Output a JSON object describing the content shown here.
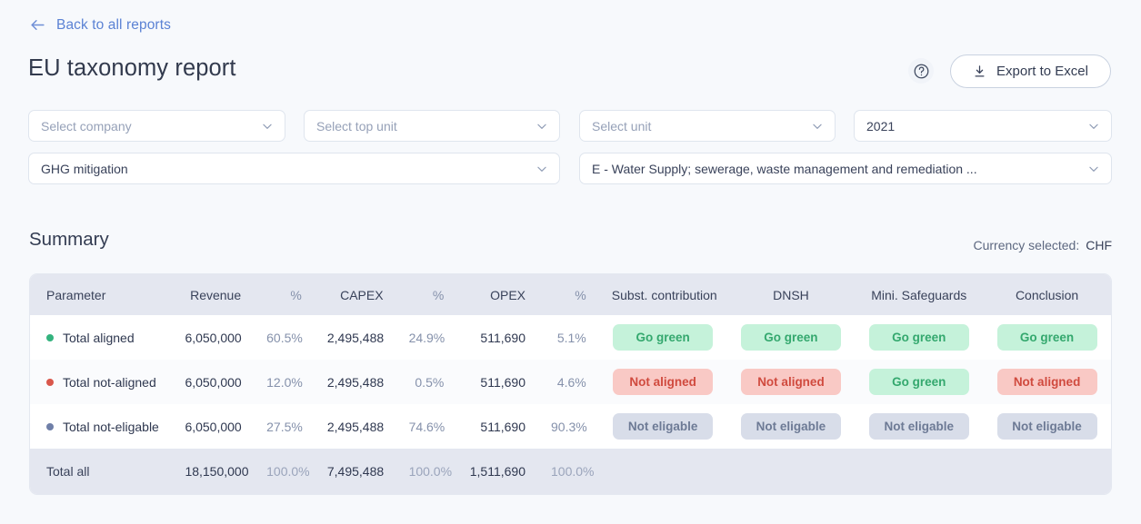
{
  "nav": {
    "back_label": "Back to all reports",
    "back_icon": "arrow-left-icon"
  },
  "header": {
    "title": "EU taxonomy report",
    "help_icon": "question-circle-icon",
    "export_label": "Export to Excel",
    "export_icon": "download-icon"
  },
  "filters": [
    {
      "name": "company",
      "value": "",
      "placeholder": "Select company",
      "is_placeholder": true
    },
    {
      "name": "top-unit",
      "value": "",
      "placeholder": "Select top unit",
      "is_placeholder": true
    },
    {
      "name": "unit",
      "value": "",
      "placeholder": "Select unit",
      "is_placeholder": true
    },
    {
      "name": "year",
      "value": "2021",
      "placeholder": "Select year",
      "is_placeholder": false
    },
    {
      "name": "objective",
      "value": "GHG mitigation",
      "placeholder": "Select objective",
      "is_placeholder": false
    },
    {
      "name": "sector",
      "value": "E - Water Supply; sewerage, waste management and remediation ...",
      "placeholder": "Select sector",
      "is_placeholder": false
    }
  ],
  "summary": {
    "title": "Summary",
    "currency_label": "Currency selected:",
    "currency_value": "CHF"
  },
  "table": {
    "columns": [
      "Parameter",
      "Revenue",
      "%",
      "CAPEX",
      "%",
      "OPEX",
      "%",
      "Subst. contribution",
      "DNSH",
      "Mini. Safeguards",
      "Conclusion"
    ],
    "rows": [
      {
        "parameter": "Total aligned",
        "dot_color": "#34b37e",
        "revenue": "6,050,000",
        "revenue_pct": "60.5%",
        "capex": "2,495,488",
        "capex_pct": "24.9%",
        "opex": "511,690",
        "opex_pct": "5.1%",
        "subst_contribution": {
          "text": "Go green",
          "style": "green"
        },
        "dnsh": {
          "text": "Go green",
          "style": "green"
        },
        "mini_safeguards": {
          "text": "Go green",
          "style": "green"
        },
        "conclusion": {
          "text": "Go green",
          "style": "green"
        }
      },
      {
        "parameter": "Total not-aligned",
        "dot_color": "#d9574b",
        "revenue": "6,050,000",
        "revenue_pct": "12.0%",
        "capex": "2,495,488",
        "capex_pct": "0.5%",
        "opex": "511,690",
        "opex_pct": "4.6%",
        "subst_contribution": {
          "text": "Not aligned",
          "style": "red"
        },
        "dnsh": {
          "text": "Not aligned",
          "style": "red"
        },
        "mini_safeguards": {
          "text": "Go green",
          "style": "green"
        },
        "conclusion": {
          "text": "Not aligned",
          "style": "red"
        }
      },
      {
        "parameter": "Total not-eligable",
        "dot_color": "#6f7fa8",
        "revenue": "6,050,000",
        "revenue_pct": "27.5%",
        "capex": "2,495,488",
        "capex_pct": "74.6%",
        "opex": "511,690",
        "opex_pct": "90.3%",
        "subst_contribution": {
          "text": "Not eligable",
          "style": "grey"
        },
        "dnsh": {
          "text": "Not eligable",
          "style": "grey"
        },
        "mini_safeguards": {
          "text": "Not eligable",
          "style": "grey"
        },
        "conclusion": {
          "text": "Not eligable",
          "style": "grey"
        }
      }
    ],
    "totals": {
      "parameter": "Total all",
      "revenue": "18,150,000",
      "revenue_pct": "100.0%",
      "capex": "7,495,488",
      "capex_pct": "100.0%",
      "opex": "1,511,690",
      "opex_pct": "100.0%",
      "subst_contribution": "",
      "dnsh": "",
      "mini_safeguards": "",
      "conclusion": ""
    }
  },
  "colors": {
    "page_bg": "#f7f9fc",
    "link": "#5b82d4",
    "header_row_bg": "#e4e7f0",
    "green_badge_bg": "#c5f2da",
    "green_badge_fg": "#34a86e",
    "red_badge_bg": "#f9c9c5",
    "red_badge_fg": "#d04a3e",
    "grey_badge_bg": "#d8dde9",
    "grey_badge_fg": "#6d7a95"
  }
}
